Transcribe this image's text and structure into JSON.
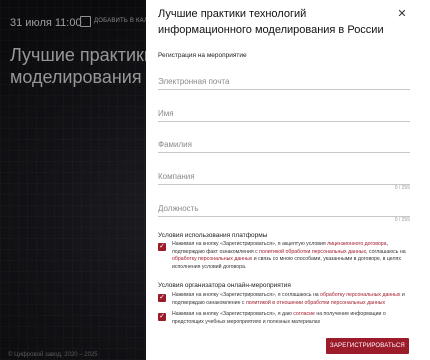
{
  "background": {
    "date": "31 июля 11:00",
    "add_calendar": "ДОБАВИТЬ В КАЛЕ",
    "title": "Лучшие практики те моделирования в Ро",
    "title_line1": "Лучшие практики те",
    "title_line2": "моделирования в Ро",
    "footer": "© Цифровой завод, 2020 – 2025"
  },
  "modal": {
    "title": "Лучшие практики технологий информационного моделирования в России",
    "close_icon": "close-icon",
    "subtitle": "Регистрация на мероприятие",
    "fields": {
      "email": {
        "placeholder": "Электронная почта"
      },
      "first_name": {
        "placeholder": "Имя"
      },
      "last_name": {
        "placeholder": "Фамилия"
      },
      "company": {
        "placeholder": "Компания",
        "counter": "0 / 255"
      },
      "position": {
        "placeholder": "Должность",
        "counter": "0 / 255"
      }
    },
    "platform_section": {
      "title": "Условия использования платформы",
      "consent": {
        "t1": "Нажимая на кнопку «Зарегистрироваться», я акцептую условия ",
        "l1": "лицензионного договора",
        "t2": ", подтверждаю факт ознакомления с ",
        "l2": "политикой обработки персональных данных",
        "t3": ", соглашаюсь на ",
        "l3": "обработку персональных данных",
        "t4": " и связь со мною способами, указанными в договоре, в целях исполнения условий договора."
      }
    },
    "organizer_section": {
      "title": "Условия организатора онлайн-мероприятия",
      "consent1": {
        "t1": "Нажимая на кнопку «Зарегистрироваться», я соглашаюсь на ",
        "l1": "обработку персональных данных",
        "t2": " и подтверждаю ознакомление с ",
        "l2": "политикой в отношении обработки персональных данных"
      },
      "consent2": {
        "t1": "Нажимая на кнопку «Зарегистрироваться», я даю ",
        "l1": "согласие",
        "t2": " на получение информации о предстоящих учебных мероприятиях и полезных материалах"
      }
    },
    "register_button": "ЗАРЕГИСТРИРОВАТЬСЯ"
  },
  "colors": {
    "accent": "#9b1b2b",
    "link": "#a0182a"
  }
}
